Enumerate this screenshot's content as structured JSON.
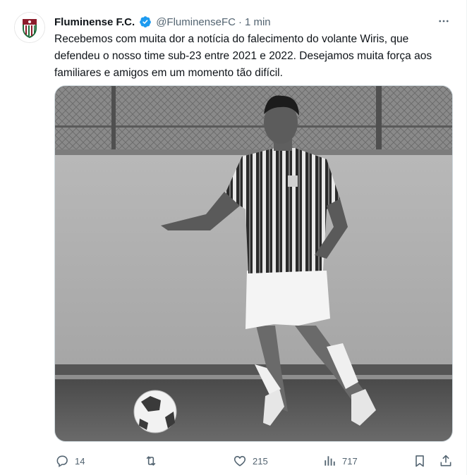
{
  "author": {
    "display_name": "Fluminense F.C.",
    "handle": "@FluminenseFC",
    "separator": "·",
    "time": "1 min"
  },
  "tweet": {
    "text": "Recebemos com muita dor a notícia do falecimento do volante Wiris, que\ndefendeu o nosso time sub-23 entre 2021 e 2022. Desejamos muita força aos\nfamiliares e amigos em um momento tão difícil."
  },
  "actions": {
    "reply_count": "14",
    "retweet_count": "",
    "like_count": "215",
    "view_count": "717"
  },
  "icons": [
    "more-icon",
    "verified-icon",
    "reply-icon",
    "retweet-icon",
    "like-icon",
    "views-icon",
    "bookmark-icon",
    "share-icon"
  ],
  "colors": {
    "verified": "#1d9bf0",
    "secondary_text": "#536471",
    "club_maroon": "#8b1c2b",
    "club_green": "#1e6b3a"
  }
}
